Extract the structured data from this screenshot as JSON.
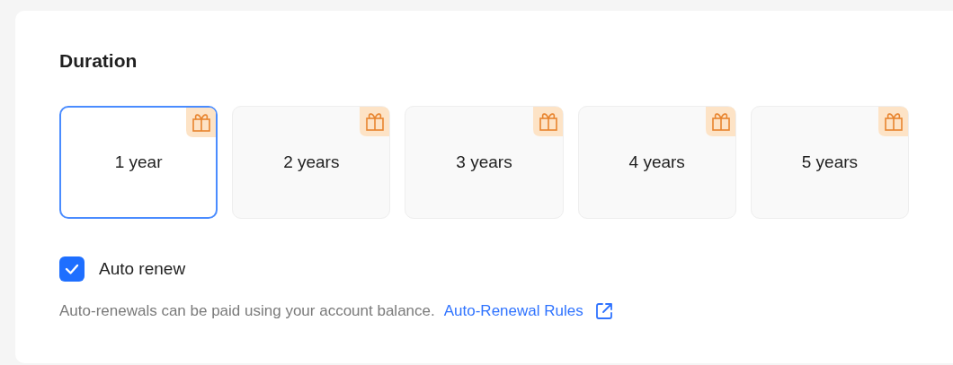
{
  "title": "Duration",
  "options": [
    {
      "label": "1 year",
      "selected": true,
      "gift": true
    },
    {
      "label": "2 years",
      "selected": false,
      "gift": true
    },
    {
      "label": "3 years",
      "selected": false,
      "gift": true
    },
    {
      "label": "4 years",
      "selected": false,
      "gift": true
    },
    {
      "label": "5 years",
      "selected": false,
      "gift": true
    }
  ],
  "auto_renew": {
    "label": "Auto renew",
    "checked": true
  },
  "note": {
    "text": "Auto-renewals can be paid using your account balance.",
    "link": "Auto-Renewal Rules"
  }
}
